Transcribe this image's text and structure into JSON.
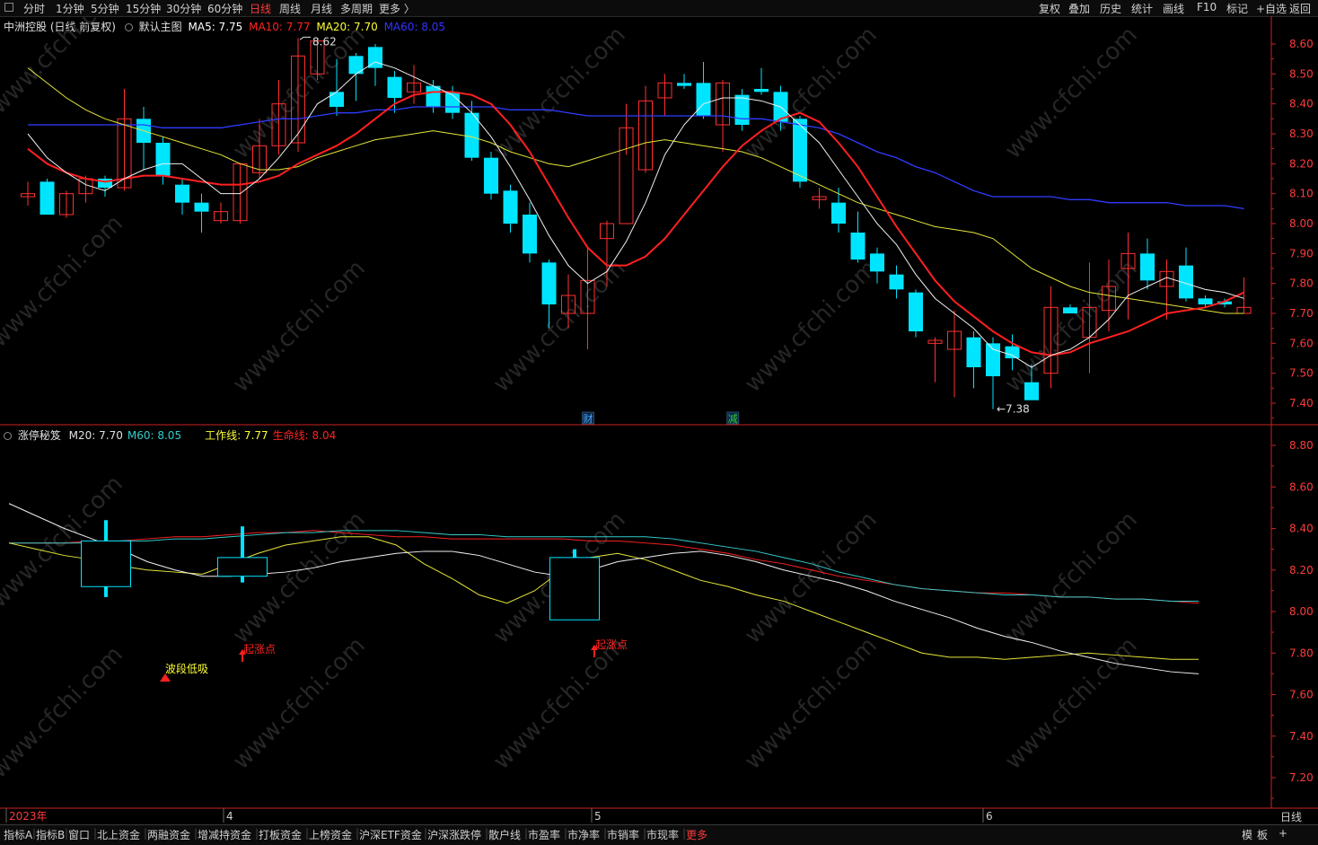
{
  "toolbar": {
    "periods": [
      "分时",
      "1分钟",
      "5分钟",
      "15分钟",
      "30分钟",
      "60分钟",
      "日线",
      "周线",
      "月线",
      "多周期",
      "更多 〉"
    ],
    "active_period": "日线",
    "right_buttons": [
      "复权",
      "叠加",
      "历史",
      "统计",
      "画线",
      "F10",
      "标记",
      "+自选",
      "返回"
    ]
  },
  "main_panel": {
    "stock": "中洲控股 (日线,前复权)",
    "template": "默认主图",
    "ma": [
      {
        "label": "MA5: 7.75",
        "color": "#ffffff"
      },
      {
        "label": "MA10: 7.77",
        "color": "#ff2222"
      },
      {
        "label": "MA20: 7.70",
        "color": "#ffff33"
      },
      {
        "label": "MA60: 8.05",
        "color": "#3333ff"
      }
    ],
    "y_ticks": [
      "8.60",
      "8.50",
      "8.40",
      "8.30",
      "8.20",
      "8.10",
      "8.00",
      "7.90",
      "7.80",
      "7.70",
      "7.60",
      "7.50",
      "7.40"
    ],
    "high_marker": "8.62",
    "low_marker": "←7.38",
    "event_markers": [
      {
        "label": "财",
        "color": "#4da6ff"
      },
      {
        "label": "减",
        "color": "#33cc33"
      }
    ]
  },
  "sub_panel": {
    "indicator": "涨停秘笈",
    "values": [
      {
        "label": "M20: 7.70",
        "color": "#e0e0e0"
      },
      {
        "label": "M60: 8.05",
        "color": "#33cccc"
      },
      {
        "label": "工作线: 7.77",
        "color": "#ffff33"
      },
      {
        "label": "生命线: 8.04",
        "color": "#ff2222"
      }
    ],
    "y_ticks": [
      "8.80",
      "8.60",
      "8.40",
      "8.20",
      "8.00",
      "7.80",
      "7.60",
      "7.40",
      "7.20"
    ],
    "signals": [
      {
        "label": "波段低吸",
        "color": "#ffff33"
      },
      {
        "label": "起涨点",
        "color": "#ff2222"
      },
      {
        "label": "起涨点",
        "color": "#ff2222"
      }
    ]
  },
  "x_axis": {
    "labels": [
      "2023年",
      "4",
      "5",
      "6"
    ],
    "right_label": "日线"
  },
  "bottom_tabs": [
    "指标A",
    "指标B",
    "窗口",
    "北上资金",
    "两融资金",
    "增减持资金",
    "打板资金",
    "上榜资金",
    "沪深ETF资金",
    "沪深涨跌停",
    "散户线",
    "市盈率",
    "市净率",
    "市销率",
    "市现率",
    "更多"
  ],
  "bottom_right": [
    "模",
    "板",
    "+"
  ],
  "watermark": "www.cfchi.com",
  "colors": {
    "up": "#ff3030",
    "down": "#00e5ff",
    "grid": "#8b0000",
    "axis": "#cc2222"
  },
  "chart_data": {
    "type": "candlestick",
    "candles": [
      [
        8.09,
        8.1,
        8.14,
        8.06
      ],
      [
        8.14,
        8.03,
        8.15,
        8.03
      ],
      [
        8.03,
        8.1,
        8.11,
        8.02
      ],
      [
        8.1,
        8.15,
        8.16,
        8.07
      ],
      [
        8.15,
        8.12,
        8.16,
        8.09
      ],
      [
        8.12,
        8.35,
        8.45,
        8.11
      ],
      [
        8.35,
        8.27,
        8.39,
        8.18
      ],
      [
        8.27,
        8.16,
        8.29,
        8.13
      ],
      [
        8.13,
        8.07,
        8.15,
        8.03
      ],
      [
        8.07,
        8.04,
        8.1,
        7.97
      ],
      [
        8.01,
        8.04,
        8.07,
        8.0
      ],
      [
        8.01,
        8.2,
        8.2,
        8.0
      ],
      [
        8.17,
        8.26,
        8.35,
        8.15
      ],
      [
        8.26,
        8.4,
        8.48,
        8.23
      ],
      [
        8.27,
        8.56,
        8.62,
        8.24
      ],
      [
        8.5,
        8.61,
        8.62,
        8.48
      ],
      [
        8.44,
        8.39,
        8.55,
        8.36
      ],
      [
        8.56,
        8.5,
        8.57,
        8.41
      ],
      [
        8.59,
        8.52,
        8.6,
        8.46
      ],
      [
        8.49,
        8.42,
        8.51,
        8.37
      ],
      [
        8.44,
        8.47,
        8.53,
        8.4
      ],
      [
        8.46,
        8.39,
        8.48,
        8.37
      ],
      [
        8.44,
        8.37,
        8.46,
        8.35
      ],
      [
        8.37,
        8.22,
        8.41,
        8.21
      ],
      [
        8.22,
        8.1,
        8.24,
        8.08
      ],
      [
        8.11,
        8.0,
        8.13,
        7.97
      ],
      [
        8.03,
        7.9,
        8.07,
        7.87
      ],
      [
        7.87,
        7.73,
        7.88,
        7.65
      ],
      [
        7.7,
        7.76,
        7.83,
        7.65
      ],
      [
        7.7,
        7.81,
        7.92,
        7.58
      ],
      [
        7.95,
        8.0,
        8.01,
        7.79
      ],
      [
        8.0,
        8.32,
        8.4,
        8.23
      ],
      [
        8.18,
        8.41,
        8.46,
        8.17
      ],
      [
        8.42,
        8.47,
        8.5,
        8.36
      ],
      [
        8.47,
        8.46,
        8.5,
        8.45
      ],
      [
        8.47,
        8.36,
        8.54,
        8.35
      ],
      [
        8.33,
        8.47,
        8.48,
        8.24
      ],
      [
        8.43,
        8.33,
        8.45,
        8.31
      ],
      [
        8.45,
        8.44,
        8.52,
        8.43
      ],
      [
        8.44,
        8.34,
        8.46,
        8.31
      ],
      [
        8.35,
        8.14,
        8.36,
        8.12
      ],
      [
        8.08,
        8.09,
        8.12,
        8.05
      ],
      [
        8.07,
        8.0,
        8.12,
        7.97
      ],
      [
        7.97,
        7.88,
        8.04,
        7.87
      ],
      [
        7.9,
        7.84,
        7.92,
        7.8
      ],
      [
        7.83,
        7.78,
        7.86,
        7.75
      ],
      [
        7.77,
        7.64,
        7.78,
        7.62
      ],
      [
        7.6,
        7.61,
        7.62,
        7.47
      ],
      [
        7.58,
        7.64,
        7.71,
        7.42
      ],
      [
        7.62,
        7.52,
        7.64,
        7.45
      ],
      [
        7.6,
        7.49,
        7.62,
        7.38
      ],
      [
        7.59,
        7.55,
        7.63,
        7.51
      ],
      [
        7.47,
        7.41,
        7.53,
        7.41
      ],
      [
        7.5,
        7.72,
        7.79,
        7.45
      ],
      [
        7.72,
        7.7,
        7.73,
        7.7
      ],
      [
        7.62,
        7.72,
        7.87,
        7.5
      ],
      [
        7.71,
        7.79,
        7.88,
        7.64
      ],
      [
        7.85,
        7.9,
        7.97,
        7.68
      ],
      [
        7.9,
        7.81,
        7.95,
        7.78
      ],
      [
        7.79,
        7.84,
        7.88,
        7.68
      ],
      [
        7.86,
        7.75,
        7.92,
        7.74
      ],
      [
        7.75,
        7.73,
        7.76,
        7.72
      ],
      [
        7.74,
        7.73,
        7.75,
        7.72
      ],
      [
        7.7,
        7.72,
        7.82,
        7.7
      ]
    ],
    "ma5": [
      8.3,
      8.22,
      8.17,
      8.13,
      8.11,
      8.15,
      8.18,
      8.2,
      8.2,
      8.15,
      8.1,
      8.1,
      8.15,
      8.22,
      8.3,
      8.4,
      8.44,
      8.5,
      8.54,
      8.52,
      8.49,
      8.46,
      8.43,
      8.37,
      8.29,
      8.19,
      8.08,
      7.96,
      7.86,
      7.8,
      7.84,
      7.94,
      8.07,
      8.23,
      8.33,
      8.4,
      8.42,
      8.42,
      8.41,
      8.39,
      8.33,
      8.27,
      8.18,
      8.09,
      8.0,
      7.93,
      7.83,
      7.75,
      7.7,
      7.65,
      7.58,
      7.56,
      7.52,
      7.56,
      7.58,
      7.62,
      7.68,
      7.76,
      7.79,
      7.82,
      7.8,
      7.78,
      7.77,
      7.75
    ],
    "ma10": [
      8.25,
      8.2,
      8.17,
      8.15,
      8.14,
      8.15,
      8.16,
      8.16,
      8.15,
      8.14,
      8.13,
      8.13,
      8.14,
      8.16,
      8.2,
      8.23,
      8.26,
      8.3,
      8.35,
      8.4,
      8.43,
      8.44,
      8.44,
      8.43,
      8.4,
      8.33,
      8.24,
      8.13,
      8.02,
      7.92,
      7.86,
      7.86,
      7.89,
      7.95,
      8.03,
      8.11,
      8.19,
      8.26,
      8.31,
      8.35,
      8.37,
      8.34,
      8.27,
      8.19,
      8.09,
      7.99,
      7.9,
      7.81,
      7.74,
      7.69,
      7.64,
      7.6,
      7.57,
      7.56,
      7.57,
      7.6,
      7.62,
      7.64,
      7.67,
      7.7,
      7.71,
      7.72,
      7.74,
      7.77
    ],
    "ma20": [
      8.52,
      8.47,
      8.42,
      8.38,
      8.35,
      8.33,
      8.31,
      8.29,
      8.27,
      8.25,
      8.23,
      8.2,
      8.18,
      8.18,
      8.19,
      8.22,
      8.24,
      8.26,
      8.28,
      8.29,
      8.3,
      8.31,
      8.3,
      8.29,
      8.27,
      8.24,
      8.22,
      8.2,
      8.19,
      8.21,
      8.23,
      8.25,
      8.27,
      8.28,
      8.27,
      8.26,
      8.25,
      8.24,
      8.22,
      8.19,
      8.16,
      8.13,
      8.1,
      8.07,
      8.05,
      8.03,
      8.01,
      7.99,
      7.98,
      7.97,
      7.95,
      7.9,
      7.85,
      7.82,
      7.79,
      7.77,
      7.76,
      7.75,
      7.74,
      7.73,
      7.72,
      7.71,
      7.7,
      7.7
    ],
    "ma60": [
      8.33,
      8.33,
      8.33,
      8.33,
      8.33,
      8.33,
      8.33,
      8.32,
      8.32,
      8.32,
      8.32,
      8.33,
      8.34,
      8.35,
      8.35,
      8.36,
      8.37,
      8.37,
      8.38,
      8.38,
      8.39,
      8.39,
      8.39,
      8.39,
      8.39,
      8.38,
      8.38,
      8.38,
      8.37,
      8.36,
      8.36,
      8.36,
      8.36,
      8.36,
      8.36,
      8.36,
      8.36,
      8.35,
      8.35,
      8.34,
      8.33,
      8.32,
      8.3,
      8.27,
      8.24,
      8.22,
      8.19,
      8.17,
      8.14,
      8.11,
      8.09,
      8.09,
      8.09,
      8.09,
      8.08,
      8.08,
      8.07,
      8.07,
      8.07,
      8.07,
      8.06,
      8.06,
      8.06,
      8.05
    ],
    "sub_m20": [
      8.52,
      8.46,
      8.4,
      8.35,
      8.3,
      8.24,
      8.2,
      8.17,
      8.17,
      8.18,
      8.19,
      8.21,
      8.24,
      8.26,
      8.28,
      8.29,
      8.29,
      8.27,
      8.23,
      8.19,
      8.17,
      8.2,
      8.24,
      8.26,
      8.28,
      8.29,
      8.27,
      8.24,
      8.2,
      8.17,
      8.14,
      8.1,
      8.05,
      8.01,
      7.97,
      7.92,
      7.88,
      7.85,
      7.81,
      7.78,
      7.75,
      7.73,
      7.71,
      7.7
    ],
    "sub_work": [
      8.33,
      8.3,
      8.27,
      8.25,
      8.22,
      8.2,
      8.19,
      8.18,
      8.23,
      8.28,
      8.32,
      8.34,
      8.36,
      8.36,
      8.32,
      8.23,
      8.16,
      8.08,
      8.04,
      8.1,
      8.2,
      8.26,
      8.28,
      8.25,
      8.2,
      8.15,
      8.12,
      8.08,
      8.05,
      8.0,
      7.95,
      7.9,
      7.85,
      7.8,
      7.78,
      7.78,
      7.77,
      7.78,
      7.79,
      7.8,
      7.79,
      7.78,
      7.77,
      7.77
    ],
    "sub_m60": [
      8.33,
      8.33,
      8.33,
      8.33,
      8.34,
      8.34,
      8.35,
      8.35,
      8.36,
      8.37,
      8.38,
      8.38,
      8.39,
      8.39,
      8.39,
      8.38,
      8.37,
      8.37,
      8.36,
      8.36,
      8.36,
      8.36,
      8.36,
      8.36,
      8.35,
      8.33,
      8.31,
      8.29,
      8.26,
      8.23,
      8.19,
      8.16,
      8.13,
      8.11,
      8.1,
      8.09,
      8.08,
      8.08,
      8.07,
      8.07,
      8.06,
      8.06,
      8.05,
      8.05
    ],
    "sub_life": [
      8.33,
      8.33,
      8.33,
      8.34,
      8.34,
      8.35,
      8.36,
      8.36,
      8.37,
      8.38,
      8.38,
      8.39,
      8.38,
      8.37,
      8.36,
      8.36,
      8.35,
      8.35,
      8.35,
      8.35,
      8.35,
      8.34,
      8.34,
      8.33,
      8.32,
      8.3,
      8.28,
      8.25,
      8.23,
      8.2,
      8.17,
      8.15,
      8.13,
      8.11,
      8.1,
      8.09,
      8.09,
      8.08,
      8.07,
      8.07,
      8.06,
      8.06,
      8.05,
      8.04
    ],
    "sub_boxes": [
      {
        "x_index": 4.5,
        "top": 8.34,
        "bottom": 8.12,
        "high": 8.44,
        "low": 8.07
      },
      {
        "x_index": 11.5,
        "top": 8.26,
        "bottom": 8.17,
        "high": 8.41,
        "low": 8.14
      },
      {
        "x_index": 29.5,
        "top": 8.26,
        "bottom": 7.96,
        "high": 8.3,
        "low": 8.26
      }
    ]
  }
}
